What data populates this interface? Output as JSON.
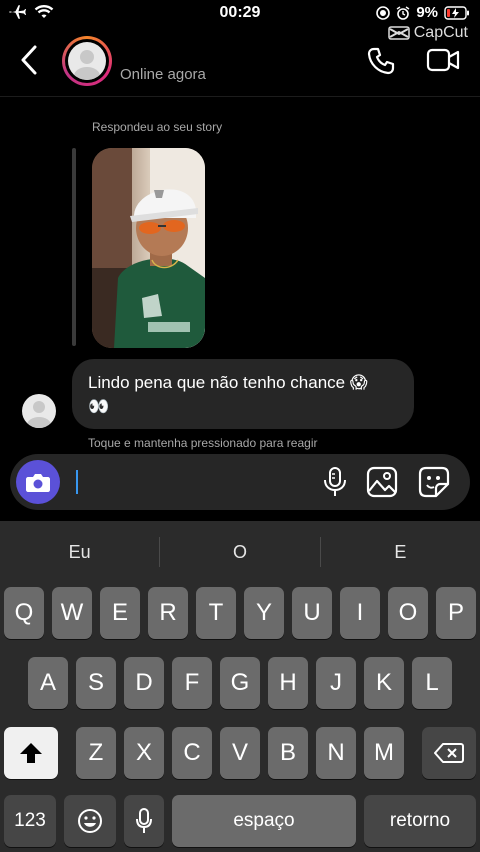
{
  "status_bar": {
    "time": "00:29",
    "battery": "9%"
  },
  "watermark": "CapCut",
  "header": {
    "status": "Online agora"
  },
  "chat": {
    "story_caption": "Respondeu ao seu story",
    "message_line1": "Lindo pena que não tenho chance 😱",
    "message_line2": "👀",
    "hint": "Toque e mantenha pressionado para reagir"
  },
  "composer": {
    "placeholder": ""
  },
  "keyboard": {
    "suggestions": [
      "Eu",
      "O",
      "E"
    ],
    "row1": [
      "Q",
      "W",
      "E",
      "R",
      "T",
      "Y",
      "U",
      "I",
      "O",
      "P"
    ],
    "row2": [
      "A",
      "S",
      "D",
      "F",
      "G",
      "H",
      "J",
      "K",
      "L"
    ],
    "row3": [
      "Z",
      "X",
      "C",
      "V",
      "B",
      "N",
      "M"
    ],
    "numbers_key": "123",
    "space_key": "espaço",
    "return_key": "retorno"
  },
  "colors": {
    "accent": "#5b51d8",
    "bubble": "#262626",
    "keyboard_bg": "#2b2b2b",
    "key": "#6b6b6b"
  }
}
